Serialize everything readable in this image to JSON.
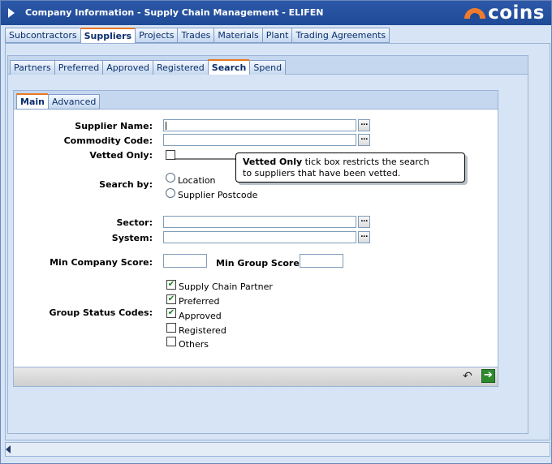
{
  "window": {
    "title": "Company Information - Supply Chain Management - ELIFEN",
    "logo_text": "COINS",
    "logo_color": "#f07c2b"
  },
  "top_tabs": [
    "Subcontractors",
    "Suppliers",
    "Projects",
    "Trades",
    "Materials",
    "Plant",
    "Trading Agreements"
  ],
  "top_tabs_active": "Suppliers",
  "mid_tabs": [
    "Partners",
    "Preferred",
    "Approved",
    "Registered",
    "Search",
    "Spend"
  ],
  "mid_tabs_active": "Search",
  "inner_tabs": [
    "Main",
    "Advanced"
  ],
  "inner_tabs_active": "Main",
  "form": {
    "supplier_name_label": "Supplier Name:",
    "supplier_name_value": "",
    "commodity_code_label": "Commodity Code:",
    "commodity_code_value": "",
    "vetted_only_label": "Vetted Only:",
    "vetted_only_checked": false,
    "search_by_label": "Search by:",
    "search_by_options": [
      "Location",
      "Supplier Postcode"
    ],
    "sector_label": "Sector:",
    "sector_value": "",
    "system_label": "System:",
    "system_value": "",
    "min_company_score_label": "Min Company Score:",
    "min_company_score_value": "",
    "min_group_score_label": "Min Group Score:",
    "min_group_score_value": "",
    "group_status_label": "Group Status Codes:",
    "group_status_options": [
      {
        "label": "Supply Chain Partner",
        "checked": true
      },
      {
        "label": "Preferred",
        "checked": true
      },
      {
        "label": "Approved",
        "checked": true
      },
      {
        "label": "Registered",
        "checked": false
      },
      {
        "label": "Others",
        "checked": false
      }
    ],
    "lookup_button_text": "..."
  },
  "callout": {
    "bold_text": "Vetted Only",
    "text_line1": " tick box restricts the search",
    "text_line2": "to suppliers that have been vetted."
  },
  "icons": {
    "undo": "undo-icon",
    "go": "arrow-right-icon"
  }
}
